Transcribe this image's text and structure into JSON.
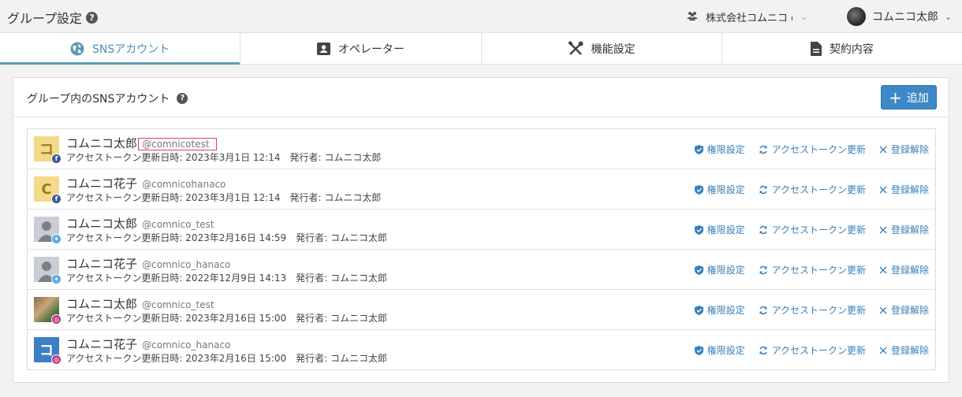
{
  "header": {
    "title": "グループ設定",
    "company": "株式会社コムニコ comnico",
    "user_name": "コムニコ太郎"
  },
  "tabs": [
    {
      "label": "SNSアカウント",
      "icon": "globe-icon",
      "active": true
    },
    {
      "label": "オペレーター",
      "icon": "id-card-icon",
      "active": false
    },
    {
      "label": "機能設定",
      "icon": "tools-icon",
      "active": false
    },
    {
      "label": "契約内容",
      "icon": "document-icon",
      "active": false
    }
  ],
  "panel": {
    "title": "グループ内のSNSアカウント",
    "add_label": "追加"
  },
  "actions": {
    "permissions": "権限設定",
    "refresh_token": "アクセストークン更新",
    "unregister": "登録解除"
  },
  "accounts": [
    {
      "name": "コムニコ太郎",
      "handle": "@comnicotest",
      "network": "facebook",
      "avatar_char": "コ",
      "updated": "アクセストークン更新日時: 2023年3月1日 12:14　発行者: コムニコ太郎"
    },
    {
      "name": "コムニコ花子",
      "handle": "@comnicohanaco",
      "network": "facebook",
      "avatar_char": "C",
      "updated": "アクセストークン更新日時: 2023年3月1日 12:14　発行者: コムニコ太郎"
    },
    {
      "name": "コムニコ太郎",
      "handle": "@comnico_test",
      "network": "twitter",
      "avatar_char": "",
      "updated": "アクセストークン更新日時: 2023年2月16日 14:59　発行者: コムニコ太郎"
    },
    {
      "name": "コムニコ花子",
      "handle": "@comnico_hanaco",
      "network": "twitter",
      "avatar_char": "",
      "updated": "アクセストークン更新日時: 2022年12月9日 14:13　発行者: コムニコ太郎"
    },
    {
      "name": "コムニコ太郎",
      "handle": "@comnico_test",
      "network": "instagram",
      "avatar_char": "",
      "updated": "アクセストークン更新日時: 2023年2月16日 15:00　発行者: コムニコ太郎"
    },
    {
      "name": "コムニコ花子",
      "handle": "@comnico_hanaco",
      "network": "instagram",
      "avatar_char": "コ",
      "updated": "アクセストークン更新日時: 2023年2月16日 15:00　発行者: コムニコ太郎"
    }
  ],
  "colors": {
    "accent": "#3d88c6",
    "link": "#3a7fb7",
    "active_tab": "#5c9ab7",
    "highlight_box": "#d6455b",
    "facebook": "#3b5998",
    "twitter": "#55acee",
    "instagram": "#c13584"
  }
}
